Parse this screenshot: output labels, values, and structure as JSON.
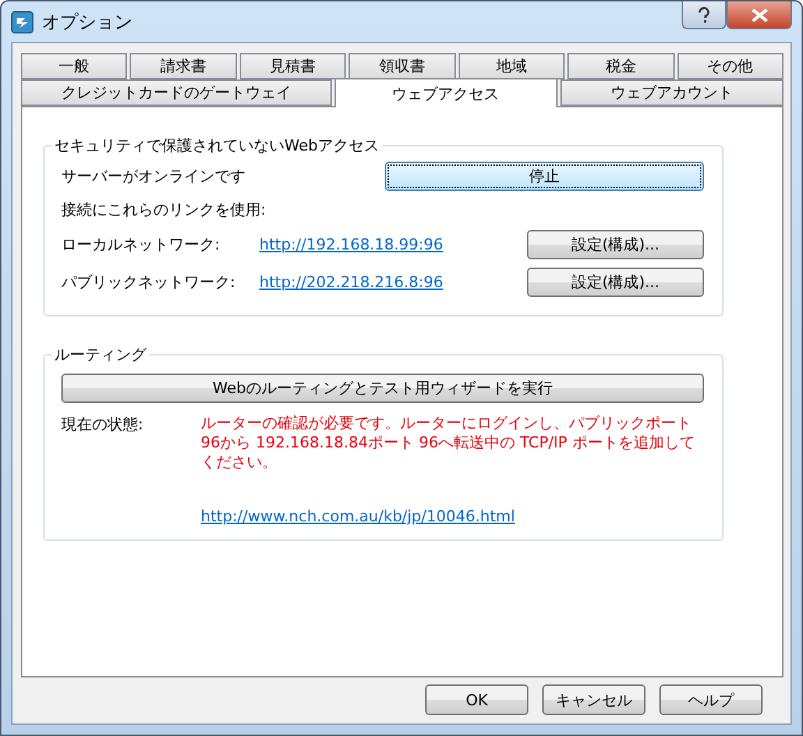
{
  "window": {
    "title": "オプション"
  },
  "tabs": [
    [
      {
        "label": "一般",
        "selected": false
      },
      {
        "label": "請求書",
        "selected": false
      },
      {
        "label": "見積書",
        "selected": false
      },
      {
        "label": "領収書",
        "selected": false
      },
      {
        "label": "地域",
        "selected": false
      },
      {
        "label": "税金",
        "selected": false
      },
      {
        "label": "その他",
        "selected": false
      }
    ],
    [
      {
        "label": "クレジットカードのゲートウェイ",
        "selected": false
      },
      {
        "label": "ウェブアクセス",
        "selected": true
      },
      {
        "label": "ウェブアカウント",
        "selected": false
      }
    ]
  ],
  "web_access": {
    "legend": "セキュリティで保護されていないWebアクセス",
    "status": "サーバーがオンラインです",
    "stop_button": {
      "label": "停止",
      "focused": true
    },
    "links_label": "接続にこれらのリンクを使用:",
    "networks": [
      {
        "label": "ローカルネットワーク:",
        "url": "http://192.168.18.99:96",
        "button": "設定(構成)..."
      },
      {
        "label": "パブリックネットワーク:",
        "url": "http://202.218.216.8:96",
        "button": "設定(構成)..."
      }
    ]
  },
  "routing": {
    "legend": "ルーティング",
    "wizard_button": "Webのルーティングとテスト用ウィザードを実行",
    "state_label": "現在の状態:",
    "state_message": "ルーターの確認が必要です。ルーターにログインし、パブリックポート 96から 192.168.18.84ポート 96へ転送中の TCP/IP ポートを追加してください。",
    "help_link": "http://www.nch.com.au/kb/jp/10046.html"
  },
  "buttons": [
    "OK",
    "キャンセル",
    "ヘルプ"
  ]
}
